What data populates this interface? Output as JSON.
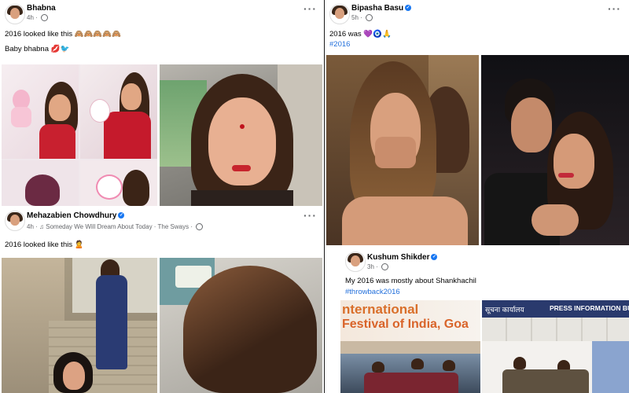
{
  "left_column": {
    "post1": {
      "author": "Bhabna",
      "time": "4h",
      "lines": [
        "2016 looked like this 🙈🙈🙈🙈🙈",
        "Baby bhabna 💋🐦"
      ]
    },
    "post2": {
      "author": "Mehazabien Chowdhury",
      "time": "4h",
      "song": "Someday We Will Dream About Today · The Sways",
      "line": "2016 looked like this 🙎"
    }
  },
  "right_column": {
    "post1": {
      "author": "Bipasha Basu",
      "time": "5h",
      "lines": [
        "2016 was 💜🧿🙏",
        "#2016"
      ]
    },
    "post2": {
      "author": "Kushum Shikder",
      "time": "3h",
      "line": "My 2016 was mostly about Shankhachil",
      "hashtag": "#throwback2016",
      "banner_left": [
        "nternational",
        "Festival of India, Goa"
      ],
      "banner_right": [
        "सूचना कार्यालय",
        "PRESS INFORMATION BU"
      ]
    }
  },
  "icons": [
    "globe-icon",
    "verified-icon",
    "more-options-icon",
    "music-note-icon"
  ],
  "colors": {
    "verified": "#1877f2",
    "hashtag": "#216fdb",
    "meta": "#65676b",
    "divider": "#1c1c1c"
  }
}
